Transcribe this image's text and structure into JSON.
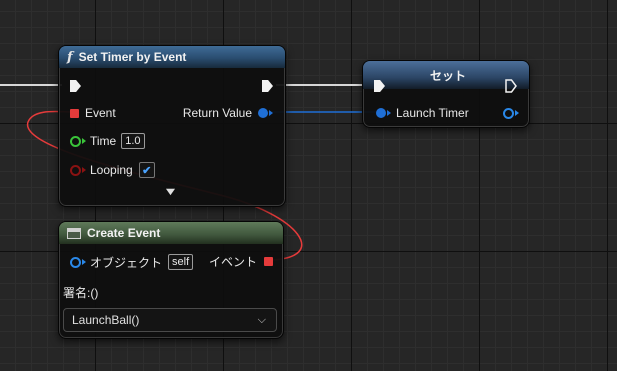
{
  "set_timer_node": {
    "title": "Set Timer by Event",
    "event_label": "Event",
    "return_value_label": "Return Value",
    "time_label": "Time",
    "time_value": "1.0",
    "looping_label": "Looping",
    "looping_checked": true,
    "expand_glyph": "⌄"
  },
  "set_node": {
    "title": "セット",
    "launch_timer_label": "Launch Timer"
  },
  "create_event_node": {
    "title": "Create Event",
    "object_label": "オブジェクト",
    "object_value": "self",
    "event_label": "イベント",
    "signature_label": "署名:()",
    "function_value": "LaunchBall()"
  },
  "colors": {
    "exec": "#f2f2f2",
    "delegate": "#e53b3b",
    "float": "#3ac43a",
    "bool": "#8a1212",
    "object": "#1f6fd6",
    "func_header": "#2a4d70",
    "create_header": "#3f563c"
  },
  "icons": {
    "function": "function-f-icon",
    "create_event": "window-icon",
    "dropdown": "chevron-down-icon",
    "checkbox": "checkmark-icon"
  }
}
